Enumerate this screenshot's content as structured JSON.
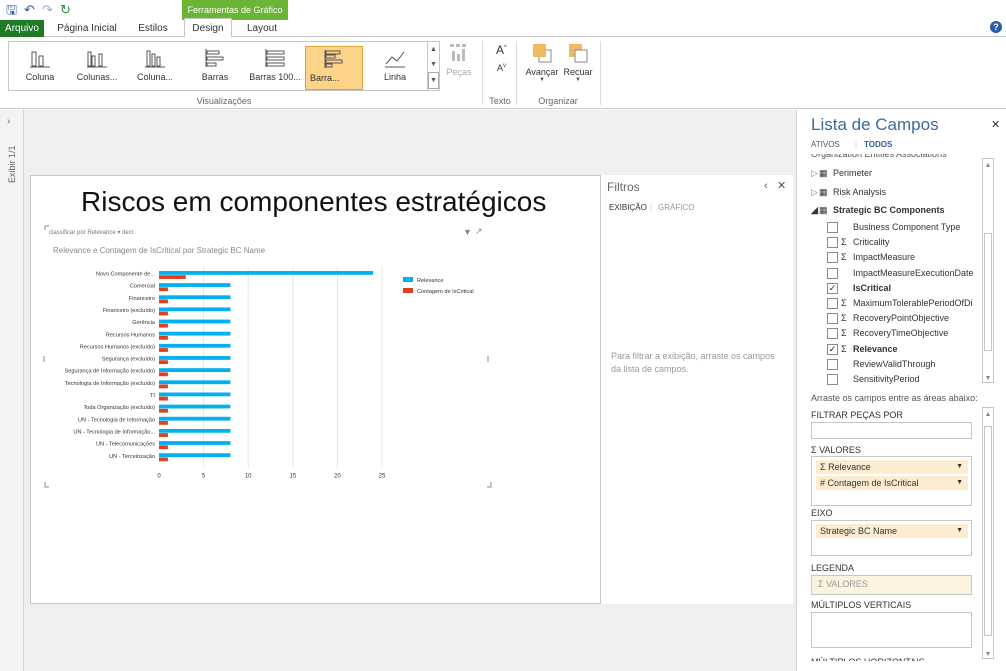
{
  "ribbon": {
    "context_header": "Ferramentas de Gráfico",
    "tabs": [
      "Arquivo",
      "Página Inicial",
      "Estilos",
      "Design",
      "Layout"
    ],
    "visualizations": [
      "Coluna",
      "Colunas...",
      "Coluna...",
      "Barras",
      "Barras 100...",
      "Barra...",
      "Linha"
    ],
    "pecas_label": "Peças",
    "groups": {
      "visualizations": "Visualizações",
      "text": "Texto",
      "organize": "Organizar"
    },
    "avancar": "Avançar",
    "recuar": "Recuar"
  },
  "left_strip": {
    "label": "Exibir 1/1"
  },
  "report": {
    "title": "Riscos em componentes estratégicos",
    "sort_label": "classificar por  Relevance",
    "sort_order": "decr",
    "chart_title": "Relevance e Contagem de IsCritical por Strategic BC Name"
  },
  "chart_data": {
    "type": "bar",
    "orientation": "horizontal",
    "title": "Relevance e Contagem de IsCritical por Strategic BC Name",
    "categories": [
      "Novo Componente de...",
      "Comercial",
      "Financeiro",
      "Financeiro (excluído)",
      "Gerência",
      "Recursos Humanos",
      "Recursos Humanos (excluído)",
      "Segurança (excluído)",
      "Segurança de Informação (excluído)",
      "Tecnologia de Informação (excluído)",
      "TI",
      "Toda Organização (excluído)",
      "UN - Tecnologia de Informação",
      "UN - Tecnologia de Informação...",
      "UN - Telecomunicações",
      "UN - Terceirização"
    ],
    "series": [
      {
        "name": "Relevance",
        "color": "#00b0f0",
        "values": [
          24,
          8,
          8,
          8,
          8,
          8,
          8,
          8,
          8,
          8,
          8,
          8,
          8,
          8,
          8,
          8
        ]
      },
      {
        "name": "Contagem de IsCritical",
        "color": "#e2401c",
        "values": [
          3,
          1,
          1,
          1,
          1,
          1,
          1,
          1,
          1,
          1,
          1,
          1,
          1,
          1,
          1,
          1
        ]
      }
    ],
    "xlim": [
      0,
      25
    ],
    "xticks": [
      0,
      5,
      10,
      15,
      20,
      25
    ],
    "grid": true,
    "legend": "top-right"
  },
  "filters": {
    "title": "Filtros",
    "tab_view": "EXIBIÇÃO",
    "tab_chart": "GRÁFICO",
    "hint": "Para filtrar a exibição, arraste os campos da lista de campos."
  },
  "field_list": {
    "title": "Lista de Campos",
    "tab_active": "ATIVOS",
    "tab_all": "TODOS",
    "top_partial": "Organization Entities Associations",
    "tables": [
      "Perimeter",
      "Risk Analysis",
      "Strategic BC Components"
    ],
    "fields": [
      {
        "name": "Business Component Type",
        "sigma": false,
        "checked": false,
        "bold": false
      },
      {
        "name": "Criticality",
        "sigma": true,
        "checked": false,
        "bold": false
      },
      {
        "name": "ImpactMeasure",
        "sigma": true,
        "checked": false,
        "bold": false
      },
      {
        "name": "ImpactMeasureExecutionDate",
        "sigma": false,
        "checked": false,
        "bold": false
      },
      {
        "name": "IsCritical",
        "sigma": false,
        "checked": true,
        "bold": true
      },
      {
        "name": "MaximumTolerablePeriodOfDi",
        "sigma": true,
        "checked": false,
        "bold": false
      },
      {
        "name": "RecoveryPointObjective",
        "sigma": true,
        "checked": false,
        "bold": false
      },
      {
        "name": "RecoveryTimeObjective",
        "sigma": true,
        "checked": false,
        "bold": false
      },
      {
        "name": "Relevance",
        "sigma": true,
        "checked": true,
        "bold": true
      },
      {
        "name": "ReviewValidThrough",
        "sigma": false,
        "checked": false,
        "bold": false
      },
      {
        "name": "SensitivityPeriod",
        "sigma": false,
        "checked": false,
        "bold": false
      }
    ],
    "drag_hint": "Arraste os campos entre as áreas abaixo:",
    "filter_by": "FILTRAR PEÇAS POR",
    "values_label": "VALORES",
    "values": [
      "Σ Relevance",
      "# Contagem de IsCritical"
    ],
    "axis_label": "EIXO",
    "axis_items": [
      "Strategic BC Name"
    ],
    "legend_label": "LEGENDA",
    "legend_placeholder": "Σ VALORES",
    "vertical_multiples": "MÚLTIPLOS VERTICAIS",
    "horizontal_multiples": "MÚLTIPLOS HORIZONTAIS"
  }
}
